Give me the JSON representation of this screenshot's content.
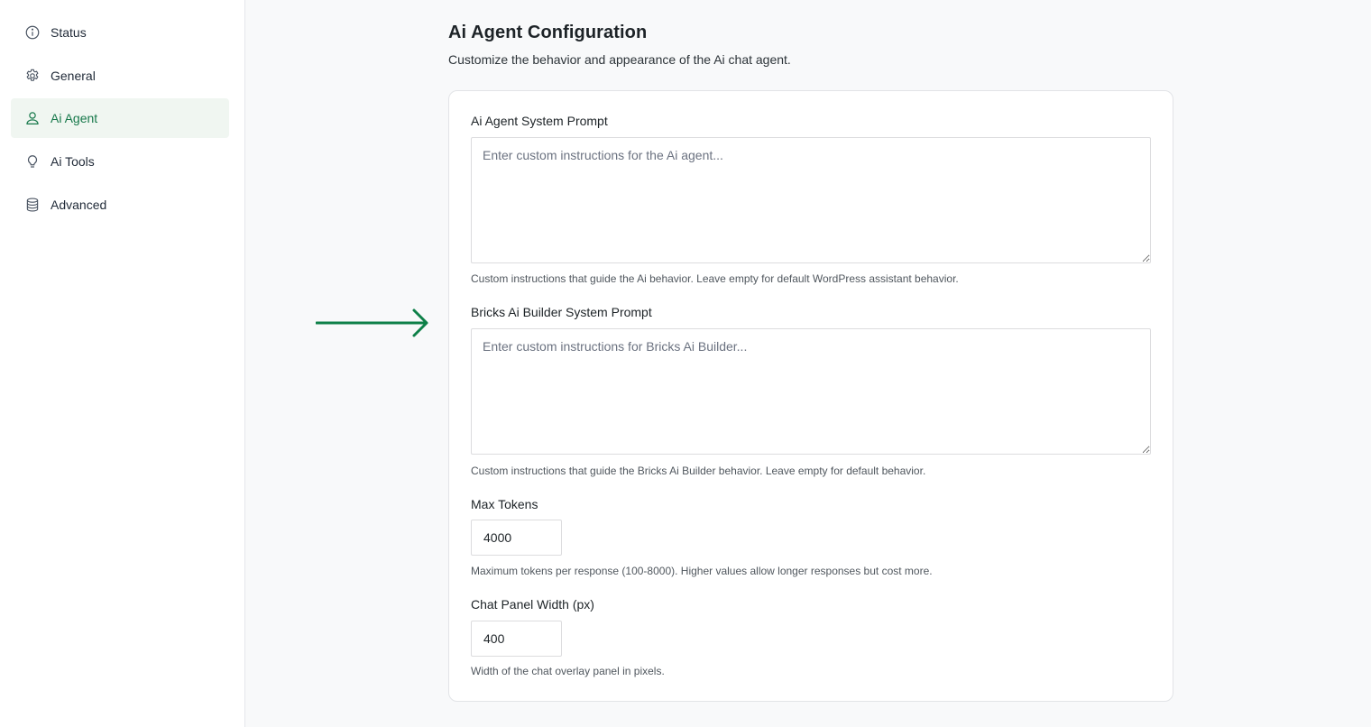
{
  "sidebar": {
    "items": [
      {
        "label": "Status",
        "icon": "info-icon",
        "active": false
      },
      {
        "label": "General",
        "icon": "gear-icon",
        "active": false
      },
      {
        "label": "Ai Agent",
        "icon": "user-icon",
        "active": true
      },
      {
        "label": "Ai Tools",
        "icon": "lightbulb-icon",
        "active": false
      },
      {
        "label": "Advanced",
        "icon": "database-icon",
        "active": false
      }
    ]
  },
  "main": {
    "title": "Ai Agent Configuration",
    "subtitle": "Customize the behavior and appearance of the Ai chat agent.",
    "fields": {
      "system_prompt": {
        "label": "Ai Agent System Prompt",
        "placeholder": "Enter custom instructions for the Ai agent...",
        "value": "",
        "help": "Custom instructions that guide the Ai behavior. Leave empty for default WordPress assistant behavior."
      },
      "bricks_prompt": {
        "label": "Bricks Ai Builder System Prompt",
        "placeholder": "Enter custom instructions for Bricks Ai Builder...",
        "value": "",
        "help": "Custom instructions that guide the Bricks Ai Builder behavior. Leave empty for default behavior."
      },
      "max_tokens": {
        "label": "Max Tokens",
        "value": "4000",
        "help": "Maximum tokens per response (100-8000). Higher values allow longer responses but cost more."
      },
      "panel_width": {
        "label": "Chat Panel Width (px)",
        "value": "400",
        "help": "Width of the chat overlay panel in pixels."
      }
    }
  },
  "colors": {
    "accent": "#16784a",
    "arrow": "#0e8048"
  }
}
